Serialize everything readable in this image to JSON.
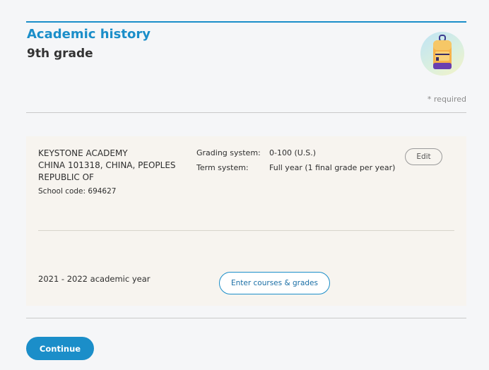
{
  "header": {
    "title": "Academic history",
    "subtitle": "9th grade",
    "avatar_icon": "backpack-icon",
    "required_note": "* required"
  },
  "school": {
    "name_lines": [
      "KEYSTONE ACADEMY",
      "CHINA 101318, CHINA, PEOPLES",
      "REPUBLIC OF"
    ],
    "code_label": "School code: 694627",
    "grading_label": "Grading system:",
    "grading_value": "0-100 (U.S.)",
    "term_label": "Term system:",
    "term_value": "Full year (1 final grade per year)",
    "edit_label": "Edit"
  },
  "year": {
    "label": "2021 - 2022 academic year",
    "enter_button": "Enter courses & grades"
  },
  "footer": {
    "continue_label": "Continue"
  },
  "colors": {
    "accent": "#1b8ec9",
    "card_bg": "#f7f4ef",
    "page_bg": "#f5f6f8"
  }
}
